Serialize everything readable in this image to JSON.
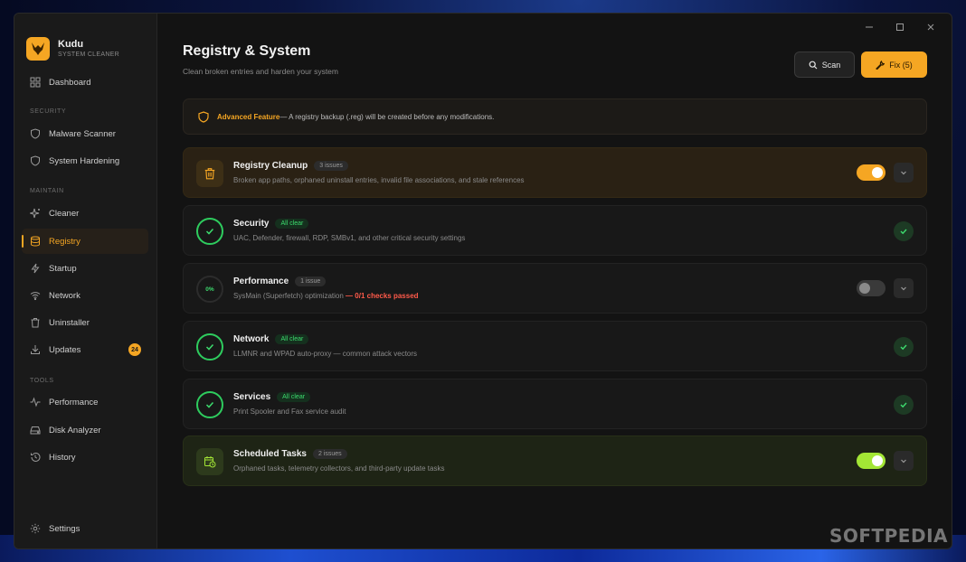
{
  "app": {
    "name": "Kudu",
    "subtitle": "SYSTEM CLEANER"
  },
  "sidebar": {
    "dashboard": "Dashboard",
    "sections": {
      "security": "SECURITY",
      "maintain": "MAINTAIN",
      "tools": "TOOLS"
    },
    "items": {
      "malware_scanner": "Malware Scanner",
      "system_hardening": "System Hardening",
      "cleaner": "Cleaner",
      "registry": "Registry",
      "startup": "Startup",
      "network": "Network",
      "uninstaller": "Uninstaller",
      "updates": "Updates",
      "updates_badge": "24",
      "performance": "Performance",
      "disk_analyzer": "Disk Analyzer",
      "history": "History"
    },
    "settings": "Settings"
  },
  "header": {
    "title": "Registry & System",
    "subtitle": "Clean broken entries and harden your system",
    "scan_label": "Scan",
    "fix_label": "Fix (5)"
  },
  "banner": {
    "highlight": "Advanced Feature",
    "text": " — A registry backup (.reg) will be created before any modifications."
  },
  "cards": [
    {
      "title": "Registry Cleanup",
      "pill": "3 issues",
      "desc": "Broken app paths, orphaned uninstall entries, invalid file associations, and stale references",
      "toggle": "on"
    },
    {
      "title": "Security",
      "pill": "All clear",
      "desc": "UAC, Defender, firewall, RDP, SMBv1, and other critical security settings"
    },
    {
      "title": "Performance",
      "pill": "1 issue",
      "ring_text": "0%",
      "desc": "SysMain (Superfetch) optimization",
      "desc_alert": " — 0/1 checks passed",
      "toggle": "off"
    },
    {
      "title": "Network",
      "pill": "All clear",
      "desc": "LLMNR and WPAD auto-proxy — common attack vectors"
    },
    {
      "title": "Services",
      "pill": "All clear",
      "desc": "Print Spooler and Fax service audit"
    },
    {
      "title": "Scheduled Tasks",
      "pill": "2 issues",
      "desc": "Orphaned tasks, telemetry collectors, and third-party update tasks",
      "toggle": "on"
    }
  ],
  "colors": {
    "accent": "#f5a623",
    "success": "#3ddc6e",
    "lime": "#a3e635",
    "danger": "#ff5a4a"
  },
  "watermark": "SOFTPEDIA"
}
